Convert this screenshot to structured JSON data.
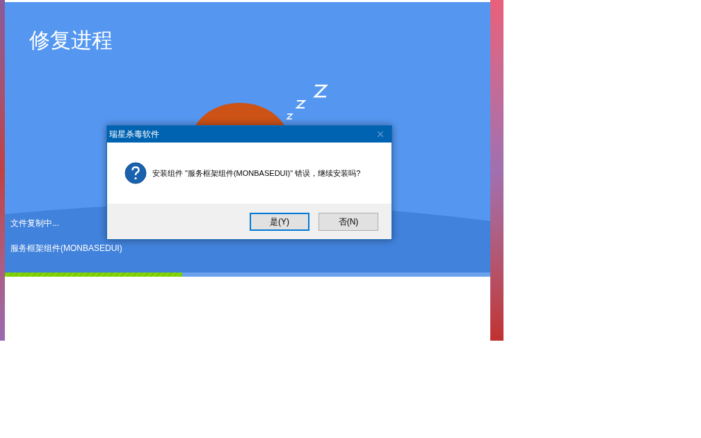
{
  "window": {
    "title": "修复进程"
  },
  "status": {
    "text": "文件复制中...",
    "component": "服务框架组件(MONBASEDUI)"
  },
  "progress": {
    "level": 0.365
  },
  "dialog": {
    "title": "瑞星杀毒软件",
    "message": "安装组件 \"服务框架组件(MONBASEDUI)\" 错误，继续安装吗?",
    "buttons": [
      {
        "label": "是(Y)",
        "selected": true
      },
      {
        "label": "否(N)",
        "selected": false
      }
    ]
  }
}
